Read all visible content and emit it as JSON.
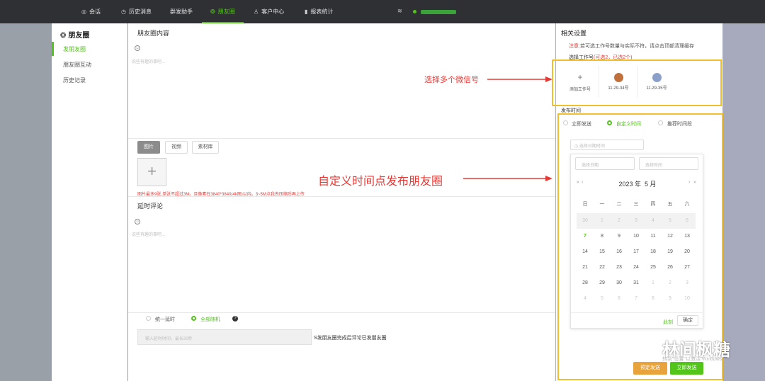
{
  "nav": {
    "items": [
      {
        "icon": "chat-icon",
        "label": "会话"
      },
      {
        "icon": "clock-icon",
        "label": "历史消息"
      },
      {
        "icon": "",
        "label": "群发助手"
      },
      {
        "icon": "moments-icon",
        "label": "朋友圈"
      },
      {
        "icon": "user-icon",
        "label": "客户中心"
      },
      {
        "icon": "chart-icon",
        "label": "报表统计"
      }
    ]
  },
  "sidebar": {
    "title": "朋友圈",
    "items": [
      "发朋友圈",
      "朋友圈互动",
      "历史记录"
    ]
  },
  "main": {
    "content_title": "朋友圈内容",
    "content_placeholder": "说些有趣的事吧...",
    "tabs": [
      "图片",
      "视频",
      "素材库"
    ],
    "upload_warning": "图片最多9张,单张不超过3M。且像素在3840*3840(4k图)以内。3~5M点我去压缩后再上传",
    "comment_title": "延时评论",
    "comment_placeholder": "说些有趣的事吧...",
    "delay_options": [
      "统一延时",
      "全部随机"
    ],
    "delay_input_placeholder": "输入延时时间，最长30秒",
    "delay_note": "S发朋友圈完成后评论已发朋友圈"
  },
  "annotations": {
    "select_accounts": "选择多个微信号",
    "custom_time": "自定义时间点发布朋友圈"
  },
  "right": {
    "title": "相关设置",
    "note_label": "注意:",
    "note_text": "若可选工作号数量与实际不符，请点击顶部清理缓存",
    "select_label": "选择工作号",
    "select_count": "(可选2，已选2个)",
    "add_account": "添加工作号",
    "accounts": [
      "11.29-34号",
      "11.29-35号"
    ],
    "publish_time_label": "发布时间",
    "publish_options": [
      "立即发送",
      "自定义时间",
      "推荐时间段"
    ],
    "date_placeholder": "选择日期时间",
    "picker": {
      "date_placeholder": "选择日期",
      "time_placeholder": "选择时间",
      "year": "2023 年",
      "month": "5 月",
      "weekdays": [
        "日",
        "一",
        "二",
        "三",
        "四",
        "五",
        "六"
      ],
      "days": [
        [
          "30",
          "1",
          "2",
          "3",
          "4",
          "5",
          "6"
        ],
        [
          "7",
          "8",
          "9",
          "10",
          "11",
          "12",
          "13"
        ],
        [
          "14",
          "15",
          "16",
          "17",
          "18",
          "19",
          "20"
        ],
        [
          "21",
          "22",
          "23",
          "24",
          "25",
          "26",
          "27"
        ],
        [
          "28",
          "29",
          "30",
          "31",
          "1",
          "2",
          "3"
        ],
        [
          "4",
          "5",
          "6",
          "7",
          "8",
          "9",
          "10"
        ]
      ],
      "now": "此刻",
      "ok": "确定"
    },
    "timed_send": "预定发送",
    "send_now": "立即发送"
  },
  "watermark": "林间枫糖",
  "windows_hint": "转到\"设置\"以激活 Windows。",
  "colors": {
    "accent": "#52c41a",
    "warning": "#e53935",
    "highlight_box": "#f0c02c",
    "topbar": "#2f3033"
  }
}
